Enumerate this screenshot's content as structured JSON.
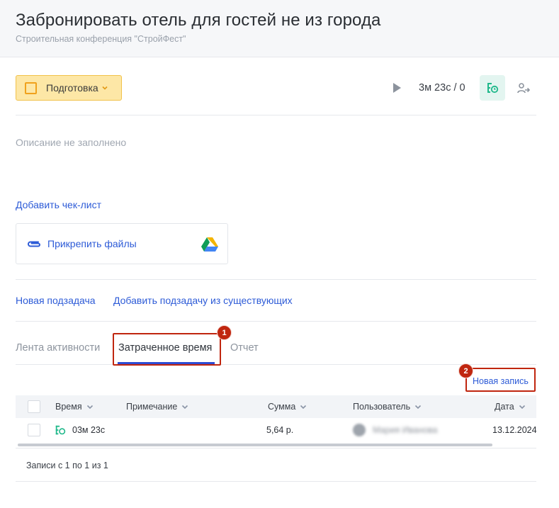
{
  "header": {
    "title": "Забронировать отель для гостей не из города",
    "subtitle": "Строительная конференция \"СтройФест\""
  },
  "toolbar": {
    "status_label": "Подготовка",
    "timer_text": "3м 23с / 0"
  },
  "description": {
    "placeholder": "Описание не заполнено"
  },
  "checklist": {
    "add_label": "Добавить чек-лист"
  },
  "attachments": {
    "attach_label": "Прикрепить файлы"
  },
  "subtasks": {
    "new_label": "Новая подзадача",
    "add_existing_label": "Добавить подзадачу из существующих"
  },
  "tabs": [
    {
      "label": "Лента активности",
      "active": false
    },
    {
      "label": "Затраченное время",
      "active": true
    },
    {
      "label": "Отчет",
      "active": false
    }
  ],
  "callouts": [
    "1",
    "2"
  ],
  "time_table": {
    "new_record_label": "Новая запись",
    "columns": [
      "Время",
      "Примечание",
      "Сумма",
      "Пользователь",
      "Дата"
    ],
    "rows": [
      {
        "time": "03м 23с",
        "note": "",
        "sum": "5,64 р.",
        "user": "Мария Иванова",
        "date": "13.12.2024"
      }
    ],
    "footer": "Записи с 1 по 1 из 1"
  },
  "colors": {
    "accent": "#2d5bd7",
    "status_bg": "#fde7a6",
    "callout": "#c0260f",
    "timer_green": "#1fb88a"
  }
}
